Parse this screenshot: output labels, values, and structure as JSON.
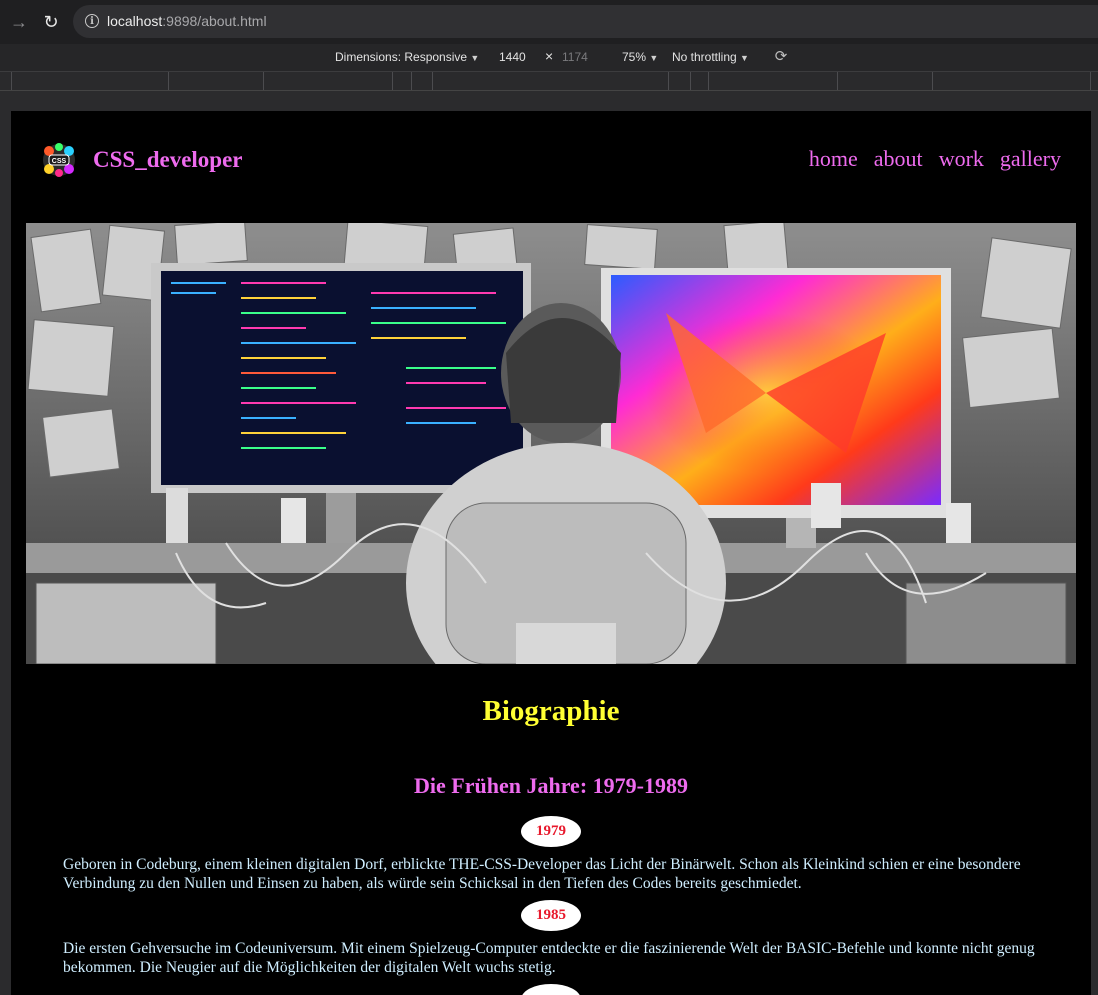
{
  "browser": {
    "url_host": "localhost",
    "url_path": ":9898/about.html"
  },
  "devtools": {
    "dimensions_label": "Dimensions: Responsive",
    "width": "1440",
    "times": "×",
    "height": "1174",
    "zoom": "75%",
    "throttling": "No throttling"
  },
  "site": {
    "brand": "CSS_developer",
    "logo_text": "CSS",
    "nav": [
      "home",
      "about",
      "work",
      "gallery"
    ]
  },
  "content": {
    "title": "Biographie",
    "section_title": "Die Frühen Jahre: 1979-1989",
    "entries": [
      {
        "year": "1979",
        "text": "Geboren in Codeburg, einem kleinen digitalen Dorf, erblickte THE-CSS-Developer das Licht der Binärwelt. Schon als Kleinkind schien er eine besondere Verbindung zu den Nullen und Einsen zu haben, als würde sein Schicksal in den Tiefen des Codes bereits geschmiedet."
      },
      {
        "year": "1985",
        "text": "Die ersten Gehversuche im Codeuniversum. Mit einem Spielzeug-Computer entdeckte er die faszinierende Welt der BASIC-Befehle und konnte nicht genug bekommen. Die Neugier auf die Möglichkeiten der digitalen Welt wuchs stetig."
      }
    ]
  },
  "colors": {
    "brand": "#ee6bee",
    "title": "#ffff33",
    "year": "#e8192c",
    "text": "#cfeeff"
  }
}
